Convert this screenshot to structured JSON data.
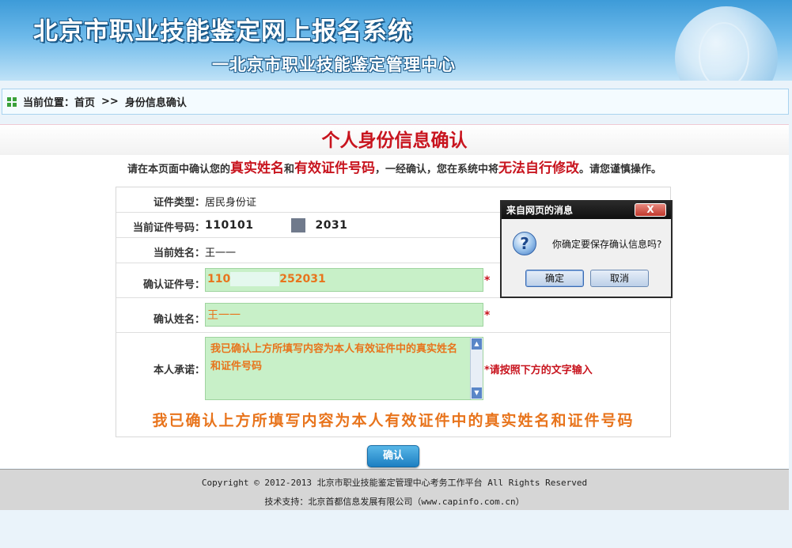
{
  "header": {
    "title": "北京市职业技能鉴定网上报名系统",
    "subtitle": "一北京市职业技能鉴定管理中心"
  },
  "breadcrumb": {
    "prefix": "当前位置：",
    "home": "首页",
    "separator": ">>",
    "current": "身份信息确认"
  },
  "panel": {
    "title": "个人身份信息确认",
    "notice": {
      "part1": "请在本页面中确认您的",
      "hl1": "真实姓名",
      "part2": "和",
      "hl2": "有效证件号码",
      "part3": "，一经确认，您在系统中将",
      "hl3": "无法自行修改",
      "part4": "。请您谨慎操作。"
    }
  },
  "form": {
    "id_type": {
      "label": "证件类型：",
      "value": "居民身份证"
    },
    "current_id": {
      "label": "当前证件号码：",
      "value_start": "110101",
      "value_end": "2031"
    },
    "current_name": {
      "label": "当前姓名：",
      "value": "王一一"
    },
    "confirm_id": {
      "label": "确认证件号：",
      "value_start": "110",
      "value_end": "252031",
      "required": "*"
    },
    "confirm_name": {
      "label": "确认姓名：",
      "value": "王一一",
      "required": "*"
    },
    "pledge": {
      "label": "本人承诺：",
      "value": "我已确认上方所填写内容为本人有效证件中的真实姓名和证件号码",
      "hint": "*请按照下方的文字输入"
    },
    "pledge_text": "我已确认上方所填写内容为本人有效证件中的真实姓名和证件号码",
    "submit_label": "确认"
  },
  "footer": {
    "line1": "Copyright © 2012-2013 北京市职业技能鉴定管理中心考务工作平台 All Rights Reserved",
    "line2": "技术支持：北京首都信息发展有限公司（www.capinfo.com.cn）"
  },
  "dialog": {
    "title": "来自网页的消息",
    "close": "X",
    "message": "你确定要保存确认信息吗?",
    "ok": "确定",
    "cancel": "取消",
    "icon": "question-icon"
  }
}
